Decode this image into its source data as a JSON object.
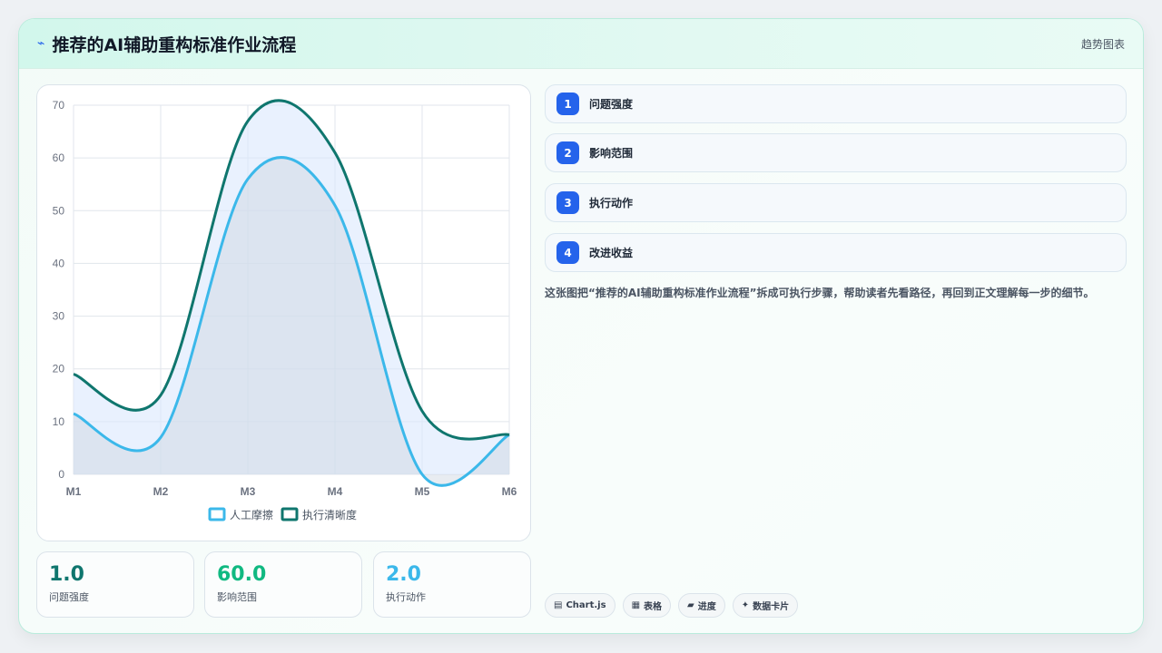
{
  "header": {
    "icon": "trend-icon",
    "title": "推荐的AI辅助重构标准作业流程",
    "tag": "趋势图表"
  },
  "chart_data": {
    "type": "line",
    "categories": [
      "M1",
      "M2",
      "M3",
      "M4",
      "M5",
      "M6"
    ],
    "yticks": [
      "0",
      "10",
      "20",
      "30",
      "40",
      "50",
      "60",
      "70"
    ],
    "ylim": [
      0,
      70
    ],
    "grid": true,
    "legend_position": "bottom",
    "series": [
      {
        "name": "人工摩擦",
        "values": [
          11.5,
          7,
          56,
          51,
          0,
          7.5
        ],
        "color": "#3bb8ea",
        "fill": "rgba(203,213,225,0.45)"
      },
      {
        "name": "执行清晰度",
        "values": [
          19,
          15,
          67,
          61,
          12,
          7.5
        ],
        "color": "#0f766e",
        "fill": "rgba(219,231,253,0.6)"
      }
    ]
  },
  "stats": [
    {
      "value": "1.0",
      "label": "问题强度",
      "color": "#0f766e"
    },
    {
      "value": "60.0",
      "label": "影响范围",
      "color": "#10b981"
    },
    {
      "value": "2.0",
      "label": "执行动作",
      "color": "#3bb8ea"
    }
  ],
  "steps": [
    {
      "num": "1",
      "label": "问题强度"
    },
    {
      "num": "2",
      "label": "影响范围"
    },
    {
      "num": "3",
      "label": "执行动作"
    },
    {
      "num": "4",
      "label": "改进收益"
    }
  ],
  "description": "这张图把“推荐的AI辅助重构标准作业流程”拆成可执行步骤，帮助读者先看路径，再回到正文理解每一步的细节。",
  "chips": [
    {
      "icon": "▤",
      "label": "Chart.js"
    },
    {
      "icon": "▦",
      "label": "表格"
    },
    {
      "icon": "▰",
      "label": "进度"
    },
    {
      "icon": "✦",
      "label": "数据卡片"
    }
  ]
}
